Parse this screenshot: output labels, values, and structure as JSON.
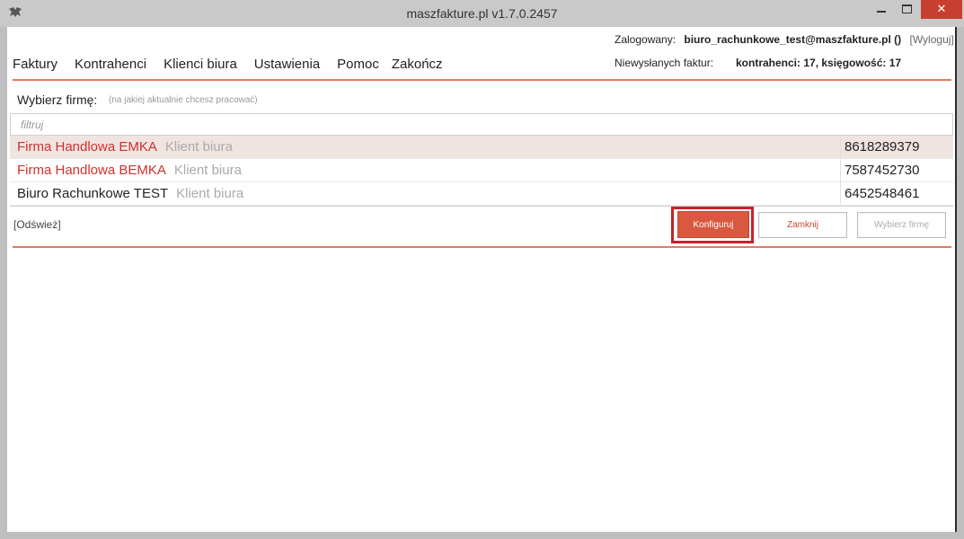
{
  "window": {
    "title": "maszfakture.pl  v1.7.0.2457"
  },
  "menu": {
    "items": [
      "Faktury",
      "Kontrahenci",
      "Klienci biura",
      "Ustawienia",
      "Pomoc",
      "Zakończ"
    ]
  },
  "status": {
    "logged_label": "Zalogowany:",
    "user": "biuro_rachunkowe_test@maszfakture.pl ()",
    "logout": "[Wyloguj]",
    "unsent_label": "Niewysłanych faktur:",
    "unsent_counts": "kontrahenci: 17, księgowość: 17"
  },
  "company_picker": {
    "label": "Wybierz firmę:",
    "hint": "(na jakiej aktualnie chcesz pracować)",
    "filter_placeholder": "filtruj",
    "rows": [
      {
        "name": "Firma Handlowa EMKA",
        "type": "Klient biura",
        "nip": "8618289379"
      },
      {
        "name": "Firma Handlowa BEMKA",
        "type": "Klient biura",
        "nip": "7587452730"
      },
      {
        "name": "Biuro Rachunkowe TEST",
        "type": "Klient biura",
        "nip": "6452548461"
      }
    ]
  },
  "actions": {
    "refresh": "[Odśwież]",
    "configure": "Konfiguruj",
    "close": "Zamknij",
    "choose": "Wybierz firmę"
  },
  "colors": {
    "accent": "#d9583f",
    "name_red": "#d0312d",
    "selected_row": "#f0e4e1",
    "close_button": "#c7402f"
  }
}
